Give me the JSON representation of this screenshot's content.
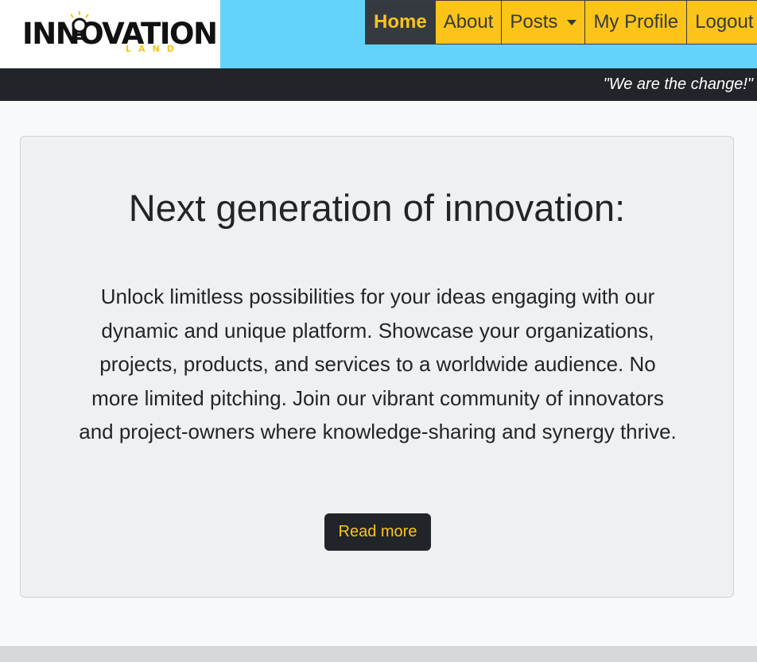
{
  "brand": {
    "logo_text": "INNOVATION",
    "logo_subtext": "LAND",
    "logo_accent": "#f5c518"
  },
  "nav": {
    "items": [
      {
        "label": "Home",
        "active": true
      },
      {
        "label": "About"
      },
      {
        "label": "Posts",
        "dropdown": true
      },
      {
        "label": "My Profile"
      },
      {
        "label": "Logout"
      }
    ]
  },
  "slogan": "\"We are the change!\"",
  "hero": {
    "title": "Next generation of innovation:",
    "text": "Unlock limitless possibilities for your ideas engaging with our dynamic and unique platform. Showcase your organizations, projects, products, and services to a worldwide audience. No more limited pitching. Join our vibrant community of innovators and project-owners where knowledge-sharing and synergy thrive.",
    "button_label": "Read more"
  },
  "colors": {
    "topbar": "#63d3f9",
    "nav_item": "#fcc419",
    "nav_active_bg": "#343a40",
    "slogan_bar": "#212529",
    "button_bg": "#212529",
    "button_text": "#fcc419"
  }
}
